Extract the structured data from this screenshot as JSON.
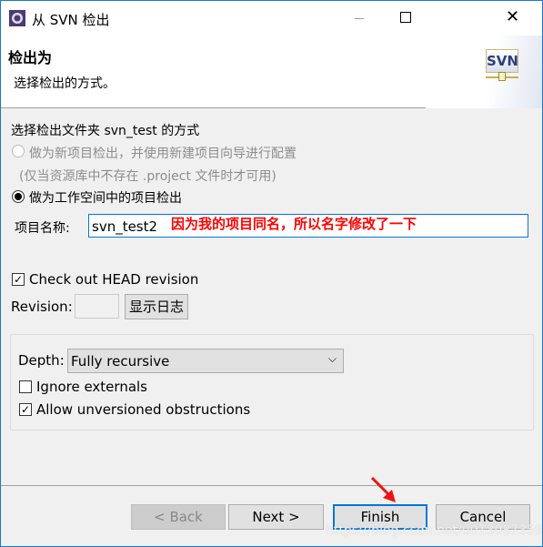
{
  "window": {
    "title": "从 SVN 检出",
    "app_icon": "eclipse-icon"
  },
  "header": {
    "title": "检出为",
    "description": "选择检出的方式。",
    "logo": "SVN"
  },
  "body": {
    "section_label": "选择检出文件夹 svn_test 的方式",
    "option_new_project": {
      "label": "做为新项目检出，并使用新建项目向导进行配置",
      "checked": false,
      "enabled": false
    },
    "option_new_project_note": "(仅当资源库中不存在 .project 文件时才可用)",
    "option_workspace": {
      "label": "做为工作空间中的项目检出",
      "checked": true
    },
    "project_name_label": "项目名称:",
    "project_name_value": "svn_test2",
    "annotation": "因为我的项目同名，所以名字修改了一下",
    "head_revision": {
      "label": "Check out HEAD revision",
      "checked": true
    },
    "revision_label": "Revision:",
    "revision_value": "",
    "show_log_label": "显示日志",
    "depth_label": "Depth:",
    "depth_value": "Fully recursive",
    "ignore_externals": {
      "label": "Ignore externals",
      "checked": false
    },
    "allow_unversioned": {
      "label": "Allow unversioned obstructions",
      "checked": true
    }
  },
  "footer": {
    "back": "< Back",
    "next": "Next >",
    "finish": "Finish",
    "cancel": "Cancel"
  },
  "watermark": "https://blog.csdn.net/u013087359",
  "colors": {
    "annotation": "#ff0000",
    "focus": "#0078d7"
  }
}
